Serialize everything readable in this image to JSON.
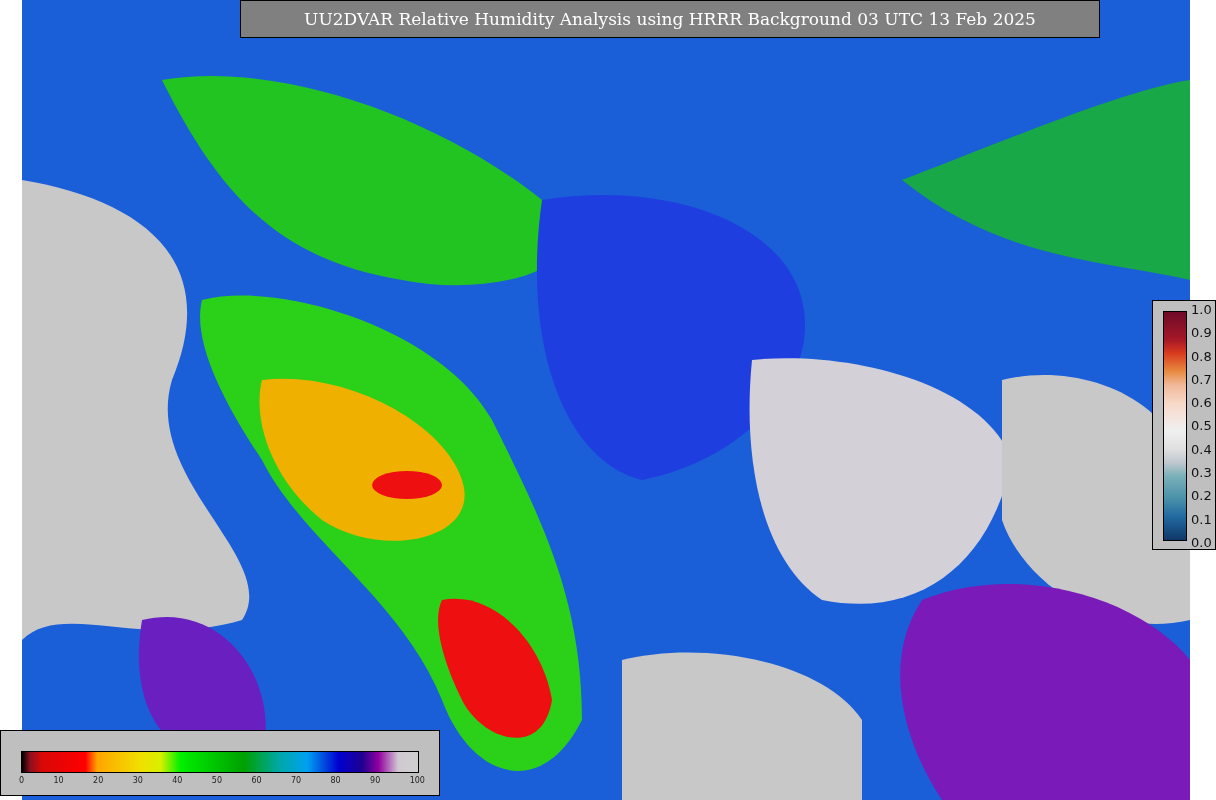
{
  "title": "UU2DVAR Relative Humidity Analysis using HRRR Background 03 UTC 13 Feb 2025",
  "humidity_colorbar": {
    "ticks": [
      "0",
      "10",
      "20",
      "30",
      "40",
      "50",
      "60",
      "70",
      "80",
      "90",
      "100"
    ]
  },
  "observation_colorbar": {
    "ticks": [
      "1.0",
      "0.9",
      "0.8",
      "0.7",
      "0.6",
      "0.5",
      "0.4",
      "0.3",
      "0.2",
      "0.1",
      "0.0"
    ]
  }
}
